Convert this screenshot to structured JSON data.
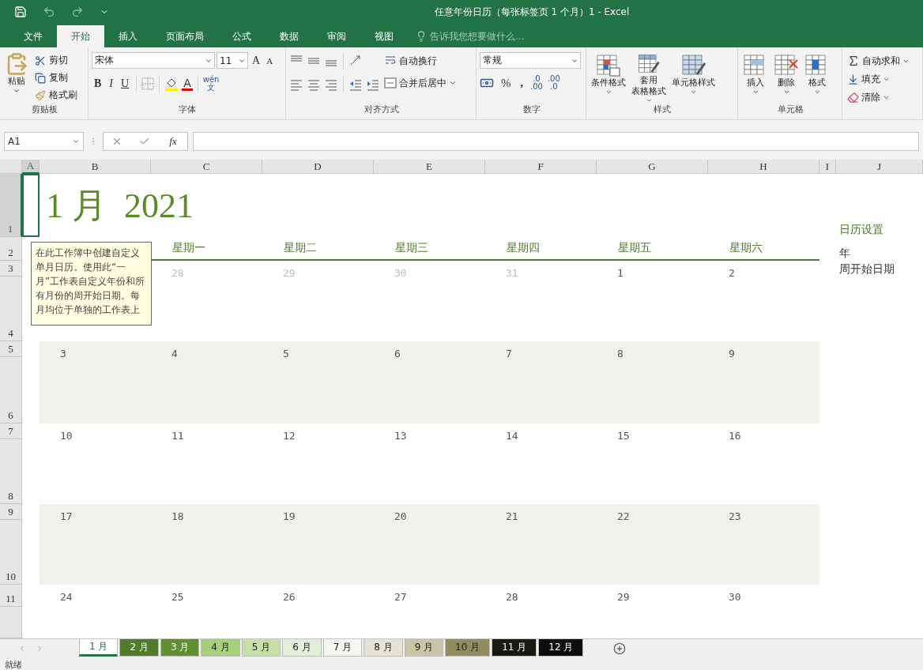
{
  "window": {
    "title": "任意年份日历（每张标签页 1 个月）1 - Excel"
  },
  "menu_tabs": [
    {
      "label": "文件",
      "selected": false
    },
    {
      "label": "开始",
      "selected": true
    },
    {
      "label": "插入",
      "selected": false
    },
    {
      "label": "页面布局",
      "selected": false
    },
    {
      "label": "公式",
      "selected": false
    },
    {
      "label": "数据",
      "selected": false
    },
    {
      "label": "审阅",
      "selected": false
    },
    {
      "label": "视图",
      "selected": false
    }
  ],
  "tell_me": {
    "placeholder": "告诉我您想要做什么..."
  },
  "ribbon": {
    "clipboard": {
      "label": "剪贴板",
      "paste": "粘贴",
      "cut": "剪切",
      "copy": "复制",
      "format_painter": "格式刷"
    },
    "font": {
      "label": "字体",
      "font_name": "宋体",
      "font_size": "11",
      "grow": "A",
      "shrink": "A",
      "bold": "B",
      "italic": "I",
      "underline": "U",
      "font_color": "A",
      "phonetic": "wén",
      "phonetic_char": "文"
    },
    "alignment": {
      "label": "对齐方式",
      "wrap_text": "自动换行",
      "merge_center": "合并后居中"
    },
    "number": {
      "label": "数字",
      "format": "常规",
      "percent": "%",
      "comma": ",",
      "increase_decimal": {
        "top": ".0",
        "bottom": ".00"
      },
      "decrease_decimal": {
        "top": ".00",
        "bottom": ".0"
      }
    },
    "styles": {
      "label": "样式",
      "buttons": [
        {
          "kind": "conditional",
          "lines": [
            "条件格式"
          ]
        },
        {
          "kind": "table",
          "lines": [
            "套用",
            "表格格式"
          ]
        },
        {
          "kind": "cell_style",
          "lines": [
            "单元格样式"
          ]
        }
      ]
    },
    "cells": {
      "label": "单元格",
      "buttons": [
        {
          "kind": "insert",
          "label": "插入"
        },
        {
          "kind": "delete",
          "label": "删除"
        },
        {
          "kind": "format",
          "label": "格式"
        }
      ]
    },
    "editing": {
      "buttons": [
        {
          "kind": "sum",
          "label": "自动求和"
        },
        {
          "kind": "fill",
          "label": "填充"
        },
        {
          "kind": "clear",
          "label": "清除"
        }
      ]
    }
  },
  "formula_bar": {
    "name_box": "A1",
    "fx": "fx"
  },
  "columns": [
    {
      "label": "A",
      "selected": true
    },
    {
      "label": "B",
      "selected": false
    },
    {
      "label": "C",
      "selected": false
    },
    {
      "label": "D",
      "selected": false
    },
    {
      "label": "E",
      "selected": false
    },
    {
      "label": "F",
      "selected": false
    },
    {
      "label": "G",
      "selected": false
    },
    {
      "label": "H",
      "selected": false
    },
    {
      "label": "I",
      "selected": false
    },
    {
      "label": "J",
      "selected": false
    }
  ],
  "rows": [
    {
      "label": "1",
      "selected": true
    },
    {
      "label": "2",
      "selected": false
    },
    {
      "label": "3",
      "selected": false
    },
    {
      "label": "4",
      "selected": false
    },
    {
      "label": "5",
      "selected": false
    },
    {
      "label": "6",
      "selected": false
    },
    {
      "label": "7",
      "selected": false
    },
    {
      "label": "8",
      "selected": false
    },
    {
      "label": "9",
      "selected": false
    },
    {
      "label": "10",
      "selected": false
    },
    {
      "label": "11",
      "selected": false
    }
  ],
  "calendar": {
    "month": "1 月",
    "year": "2021",
    "weekdays": [
      "星期一",
      "星期二",
      "星期三",
      "星期四",
      "星期五",
      "星期六"
    ],
    "weeks": [
      {
        "shaded": false,
        "days": [
          {
            "label": "28",
            "muted": true
          },
          {
            "label": "29",
            "muted": true
          },
          {
            "label": "30",
            "muted": true
          },
          {
            "label": "31",
            "muted": true
          },
          {
            "label": "1",
            "muted": false
          },
          {
            "label": "2",
            "muted": false
          }
        ]
      },
      {
        "shaded": true,
        "days": [
          {
            "label": "3",
            "muted": false
          },
          {
            "label": "4",
            "muted": false
          },
          {
            "label": "5",
            "muted": false
          },
          {
            "label": "6",
            "muted": false
          },
          {
            "label": "7",
            "muted": false
          },
          {
            "label": "8",
            "muted": false
          },
          {
            "label": "9",
            "muted": false
          }
        ]
      },
      {
        "shaded": false,
        "days": [
          {
            "label": "10",
            "muted": false
          },
          {
            "label": "11",
            "muted": false
          },
          {
            "label": "12",
            "muted": false
          },
          {
            "label": "13",
            "muted": false
          },
          {
            "label": "14",
            "muted": false
          },
          {
            "label": "15",
            "muted": false
          },
          {
            "label": "16",
            "muted": false
          }
        ]
      },
      {
        "shaded": true,
        "days": [
          {
            "label": "17",
            "muted": false
          },
          {
            "label": "18",
            "muted": false
          },
          {
            "label": "19",
            "muted": false
          },
          {
            "label": "20",
            "muted": false
          },
          {
            "label": "21",
            "muted": false
          },
          {
            "label": "22",
            "muted": false
          },
          {
            "label": "23",
            "muted": false
          }
        ]
      },
      {
        "shaded": false,
        "days": [
          {
            "label": "24",
            "muted": false
          },
          {
            "label": "25",
            "muted": false
          },
          {
            "label": "26",
            "muted": false
          },
          {
            "label": "27",
            "muted": false
          },
          {
            "label": "28",
            "muted": false
          },
          {
            "label": "29",
            "muted": false
          },
          {
            "label": "30",
            "muted": false
          }
        ]
      }
    ]
  },
  "settings": {
    "title": "日历设置",
    "items": [
      "年",
      "周开始日期"
    ]
  },
  "comment": {
    "text": "在此工作簿中创建自定义单月日历。使用此“一月”工作表自定义年份和所有月份的周开始日期。每月均位于单独的工作表上"
  },
  "sheet_tabs": [
    {
      "label": "1 月",
      "selected": true,
      "color": "#ffffff"
    },
    {
      "label": "2 月",
      "selected": false,
      "color": "#4f7b2b"
    },
    {
      "label": "3 月",
      "selected": false,
      "color": "#5f9130"
    },
    {
      "label": "4 月",
      "selected": false,
      "color": "#a6d07a"
    },
    {
      "label": "5 月",
      "selected": false,
      "color": "#c5e0a5"
    },
    {
      "label": "6 月",
      "selected": false,
      "color": "#e2efd6"
    },
    {
      "label": "7 月",
      "selected": false,
      "color": "#f7f7f2"
    },
    {
      "label": "8 月",
      "selected": false,
      "color": "#e6e3d3"
    },
    {
      "label": "9 月",
      "selected": false,
      "color": "#c8c4a4"
    },
    {
      "label": "10 月",
      "selected": false,
      "color": "#918c5c"
    },
    {
      "label": "11 月",
      "selected": false,
      "color": "#1a1a12"
    },
    {
      "label": "12 月",
      "selected": false,
      "color": "#0d0d0d"
    }
  ],
  "status_bar": {
    "text": "就绪"
  }
}
